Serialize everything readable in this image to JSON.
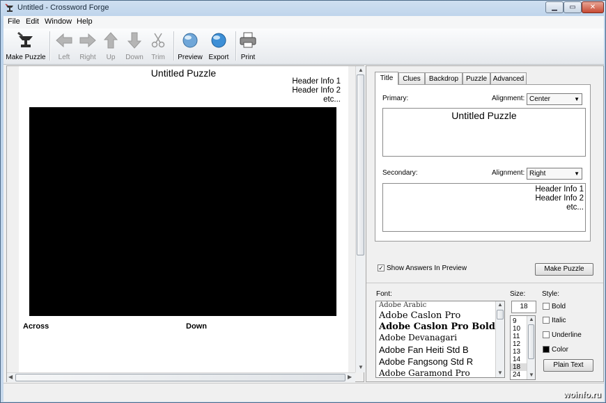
{
  "window": {
    "title": "Untitled - Crossword Forge"
  },
  "menu": [
    "File",
    "Edit",
    "Window",
    "Help"
  ],
  "toolbar": {
    "make_puzzle": "Make Puzzle",
    "left": "Left",
    "right": "Right",
    "up": "Up",
    "down": "Down",
    "trim": "Trim",
    "preview": "Preview",
    "export": "Export",
    "print": "Print"
  },
  "puzzle": {
    "title": "Untitled Puzzle",
    "header": [
      "Header Info 1",
      "Header Info 2",
      "etc..."
    ],
    "across": "Across",
    "down": "Down"
  },
  "tabs": [
    "Title",
    "Clues",
    "Backdrop",
    "Puzzle",
    "Advanced"
  ],
  "title_tab": {
    "primary_label": "Primary:",
    "alignment_label": "Alignment:",
    "primary_alignment": "Center",
    "primary_text": "Untitled Puzzle",
    "secondary_label": "Secondary:",
    "secondary_alignment": "Right",
    "secondary_lines": [
      "Header Info 1",
      "Header Info 2",
      "etc..."
    ]
  },
  "show_answers": {
    "label": "Show Answers In Preview",
    "checked": true
  },
  "make_puzzle_button": "Make Puzzle",
  "font_panel": {
    "font_label": "Font:",
    "size_label": "Size:",
    "style_label": "Style:",
    "fonts": [
      "Adobe Arabic",
      "Adobe Caslon Pro",
      "Adobe Caslon Pro Bold",
      "Adobe Devanagari",
      "Adobe Fan Heiti Std B",
      "Adobe Fangsong Std R",
      "Adobe Garamond Pro"
    ],
    "size_value": "18",
    "sizes": [
      "9",
      "10",
      "11",
      "12",
      "13",
      "14",
      "18",
      "24"
    ],
    "selected_size": "18",
    "bold": "Bold",
    "italic": "Italic",
    "underline": "Underline",
    "color": "Color",
    "plain_text": "Plain Text"
  },
  "watermark": "woinfo.ru",
  "colors": {
    "grid": "#000000",
    "accent": "#b9d1ea"
  }
}
